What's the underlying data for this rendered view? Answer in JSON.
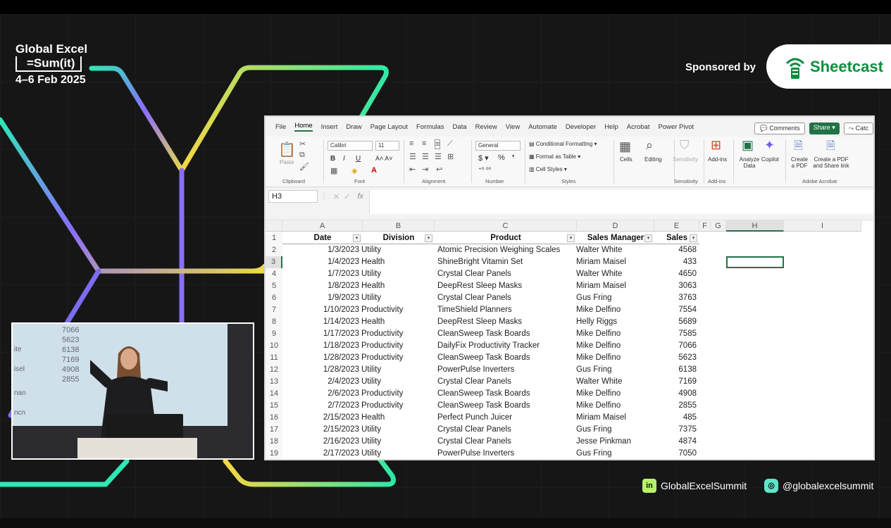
{
  "event": {
    "title": "Global Excel",
    "formula": "=Sum(it)",
    "dates": "4–6 Feb 2025"
  },
  "sponsor": {
    "label": "Sponsored by",
    "name": "Sheetcast"
  },
  "excel": {
    "menu_tabs": [
      "File",
      "Home",
      "Insert",
      "Draw",
      "Page Layout",
      "Formulas",
      "Data",
      "Review",
      "View",
      "Automate",
      "Developer",
      "Help",
      "Acrobat",
      "Power Pivot"
    ],
    "active_tab": "Home",
    "comments_label": "Comments",
    "share_label": "Share",
    "catch_label": "Catc",
    "ribbon": {
      "paste": "Paste",
      "clipboard": "Clipboard",
      "font_name": "Calibri",
      "font_size": "11",
      "font": "Font",
      "alignment": "Alignment",
      "number_format": "General",
      "number": "Number",
      "conditional_formatting": "Conditional Formatting",
      "format_as_table": "Format as Table",
      "cell_styles": "Cell Styles",
      "styles": "Styles",
      "cells": "Cells",
      "editing": "Editing",
      "sensitivity_btn": "Sensitivity",
      "sensitivity": "Sensitivity",
      "add_ins_btn": "Add-ins",
      "add_ins": "Add-ins",
      "analyze_data": "Analyze Data",
      "copilot": "Copilot",
      "create_pdf": "Create a PDF",
      "create_pdf_share": "Create a PDF and Share link",
      "adobe_acrobat": "Adobe Acrobat"
    },
    "name_box": "H3",
    "fx": "fx",
    "columns": [
      "A",
      "B",
      "C",
      "D",
      "E",
      "F",
      "G",
      "H",
      "I"
    ],
    "headers": [
      "Date",
      "Division",
      "Product",
      "Sales Manager",
      "Sales"
    ],
    "row_numbers": [
      "1",
      "2",
      "3",
      "4",
      "5",
      "6",
      "7",
      "8",
      "9",
      "10",
      "11",
      "12",
      "13",
      "14",
      "15",
      "16",
      "17",
      "18",
      "19"
    ],
    "rows": [
      [
        "1/3/2023",
        "Utility",
        "Atomic Precision Weighing Scales",
        "Walter White",
        "4568"
      ],
      [
        "1/4/2023",
        "Health",
        "ShineBright Vitamin Set",
        "Miriam Maisel",
        "433"
      ],
      [
        "1/7/2023",
        "Utility",
        "Crystal Clear Panels",
        "Walter White",
        "4650"
      ],
      [
        "1/8/2023",
        "Health",
        "DeepRest Sleep Masks",
        "Miriam Maisel",
        "3063"
      ],
      [
        "1/9/2023",
        "Utility",
        "Crystal Clear Panels",
        "Gus Fring",
        "3763"
      ],
      [
        "1/10/2023",
        "Productivity",
        "TimeShield Planners",
        "Mike Delfino",
        "7554"
      ],
      [
        "1/14/2023",
        "Health",
        "DeepRest Sleep Masks",
        "Helly Riggs",
        "5689"
      ],
      [
        "1/17/2023",
        "Productivity",
        "CleanSweep Task Boards",
        "Mike Delfino",
        "7585"
      ],
      [
        "1/18/2023",
        "Productivity",
        "DailyFix Productivity Tracker",
        "Mike Delfino",
        "7066"
      ],
      [
        "1/28/2023",
        "Productivity",
        "CleanSweep Task Boards",
        "Mike Delfino",
        "5623"
      ],
      [
        "1/28/2023",
        "Utility",
        "PowerPulse Inverters",
        "Gus Fring",
        "6138"
      ],
      [
        "2/4/2023",
        "Utility",
        "Crystal Clear Panels",
        "Walter White",
        "7169"
      ],
      [
        "2/6/2023",
        "Productivity",
        "CleanSweep Task Boards",
        "Mike Delfino",
        "4908"
      ],
      [
        "2/7/2023",
        "Productivity",
        "CleanSweep Task Boards",
        "Mike Delfino",
        "2855"
      ],
      [
        "2/15/2023",
        "Health",
        "Perfect Punch Juicer",
        "Miriam Maisel",
        "485"
      ],
      [
        "2/15/2023",
        "Utility",
        "Crystal Clear Panels",
        "Gus Fring",
        "7375"
      ],
      [
        "2/16/2023",
        "Utility",
        "Crystal Clear Panels",
        "Jesse Pinkman",
        "4874"
      ],
      [
        "2/17/2023",
        "Utility",
        "PowerPulse Inverters",
        "Gus Fring",
        "7050"
      ]
    ]
  },
  "presenter_screen": {
    "numbers": [
      "7066",
      "5623",
      "6138",
      "7169",
      "4908",
      "2855"
    ],
    "text": [
      "ite",
      "isel",
      "nan",
      "ncn"
    ]
  },
  "social": {
    "linkedin": "GlobalExcelSummit",
    "instagram": "@globalexcelsummit"
  },
  "colors": {
    "excel_green": "#217346",
    "sheetcast_green": "#0a8f3c",
    "accent_lime": "#b7f36a",
    "accent_teal": "#5ee6c9"
  }
}
